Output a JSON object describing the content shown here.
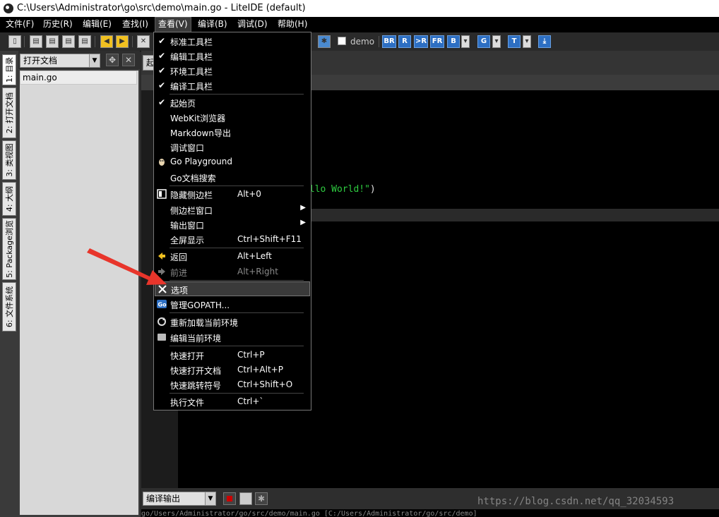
{
  "window": {
    "title": "C:\\Users\\Administrator\\go\\src\\demo\\main.go - LiteIDE (default)"
  },
  "menubar": {
    "items": [
      "文件(F)",
      "历史(R)",
      "编辑(E)",
      "查找(I)",
      "查看(V)",
      "编译(B)",
      "调试(D)",
      "帮助(H)"
    ],
    "active_index": 4
  },
  "toolbar": {
    "demo_label": "demo",
    "build_buttons": [
      "BR",
      "R",
      ">R",
      "FR",
      "B",
      "G",
      "T"
    ]
  },
  "left_tabs": [
    "1: 目录",
    "2: 打开文档",
    "3: 类视图",
    "4: 大纲",
    "5: Package浏览",
    "6: 文件系统"
  ],
  "side_panel": {
    "combo_value": "打开文档",
    "files": [
      "main.go"
    ]
  },
  "editor": {
    "tab_label": "起",
    "code_fragment_str": "ello World!\"",
    "code_fragment_punc": ")"
  },
  "bottom": {
    "output_combo": "编译输出",
    "output_text": "go/Users/Administrator/go/src/demo/main.go [C:/Users/Administrator/go/src/demo]",
    "watermark": "https://blog.csdn.net/qq_32034593"
  },
  "view_menu": {
    "items": [
      {
        "label": "标准工具栏",
        "checked": true
      },
      {
        "label": "编辑工具栏",
        "checked": true
      },
      {
        "label": "环境工具栏",
        "checked": true
      },
      {
        "label": "编译工具栏",
        "checked": true
      },
      {
        "label": "起始页",
        "checked": true
      },
      {
        "label": "WebKit浏览器"
      },
      {
        "label": "Markdown导出"
      },
      {
        "label": "调试窗口"
      },
      {
        "label": "Go Playground",
        "icon": "gopher-icon"
      },
      {
        "label": "Go文档搜索"
      },
      {
        "label": "隐藏侧边栏",
        "shortcut": "Alt+0",
        "icon": "sidebar-icon"
      },
      {
        "label": "侧边栏窗口",
        "submenu": true
      },
      {
        "label": "输出窗口",
        "submenu": true
      },
      {
        "label": "全屏显示",
        "shortcut": "Ctrl+Shift+F11"
      },
      {
        "label": "返回",
        "shortcut": "Alt+Left",
        "icon": "back-arrow-icon"
      },
      {
        "label": "前进",
        "shortcut": "Alt+Right",
        "icon": "forward-arrow-icon",
        "disabled": true
      },
      {
        "label": "选项",
        "icon": "tools-icon",
        "highlighted": true
      },
      {
        "label": "管理GOPATH...",
        "icon": "go-icon"
      },
      {
        "label": "重新加载当前环境",
        "icon": "reload-icon"
      },
      {
        "label": "编辑当前环境",
        "icon": "env-icon"
      },
      {
        "label": "快速打开",
        "shortcut": "Ctrl+P"
      },
      {
        "label": "快速打开文档",
        "shortcut": "Ctrl+Alt+P"
      },
      {
        "label": "快速跳转符号",
        "shortcut": "Ctrl+Shift+O"
      },
      {
        "label": "执行文件",
        "shortcut": "Ctrl+`"
      }
    ]
  },
  "colors": {
    "accent_blue": "#2d6fc3",
    "string_green": "#2ecc40",
    "arrow_red": "#e8352b"
  }
}
